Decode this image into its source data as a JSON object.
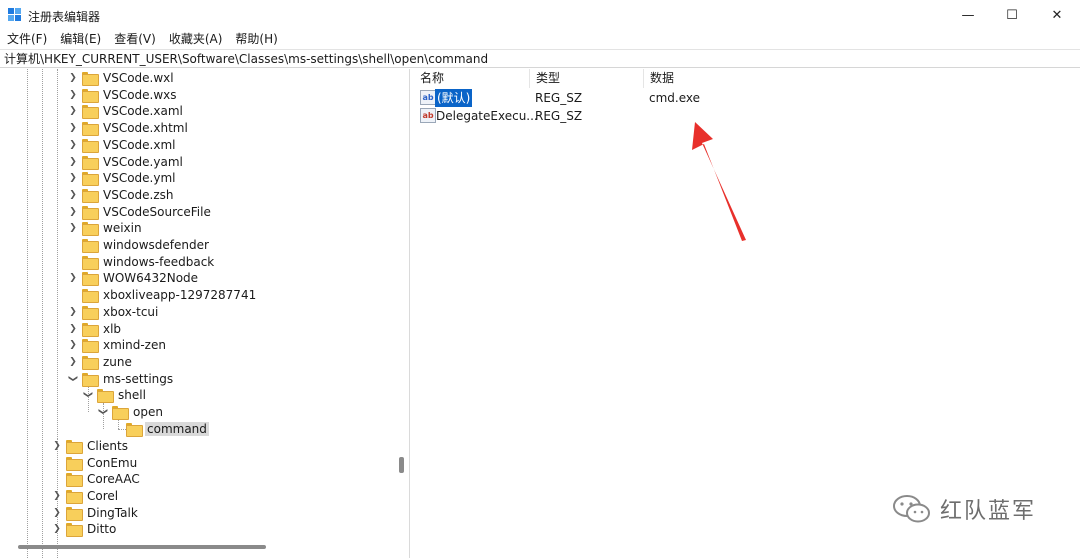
{
  "window": {
    "title": "注册表编辑器",
    "minimize_glyph": "—",
    "maximize_glyph": "☐",
    "close_glyph": "✕"
  },
  "menu": [
    "文件(F)",
    "编辑(E)",
    "查看(V)",
    "收藏夹(A)",
    "帮助(H)"
  ],
  "address": "计算机\\HKEY_CURRENT_USER\\Software\\Classes\\ms-settings\\shell\\open\\command",
  "tree": {
    "level3": [
      "VSCode.wxl",
      "VSCode.wxs",
      "VSCode.xaml",
      "VSCode.xhtml",
      "VSCode.xml",
      "VSCode.yaml",
      "VSCode.yml",
      "VSCode.zsh",
      "VSCodeSourceFile",
      "weixin",
      "windowsdefender",
      "windows-feedback",
      "WOW6432Node",
      "xboxliveapp-1297287741",
      "xbox-tcui",
      "xlb",
      "xmind-zen",
      "zune",
      "ms-settings"
    ],
    "shell": "shell",
    "open": "open",
    "command": "command",
    "level2": [
      "Clients",
      "ConEmu",
      "CoreAAC",
      "Corel",
      "DingTalk",
      "Ditto"
    ]
  },
  "list": {
    "headers": {
      "name": "名称",
      "type": "类型",
      "data": "数据"
    },
    "rows": [
      {
        "name": "(默认)",
        "type": "REG_SZ",
        "data": "cmd.exe",
        "icon": "reg-string-icon"
      },
      {
        "name": "DelegateExecu...",
        "type": "REG_SZ",
        "data": "",
        "icon": "reg-string-icon"
      }
    ]
  },
  "watermark": {
    "text": "红队蓝军"
  },
  "colors": {
    "selection": "#0a64c8",
    "arrow": "#e8302b",
    "folder": "#f8cf5b"
  }
}
